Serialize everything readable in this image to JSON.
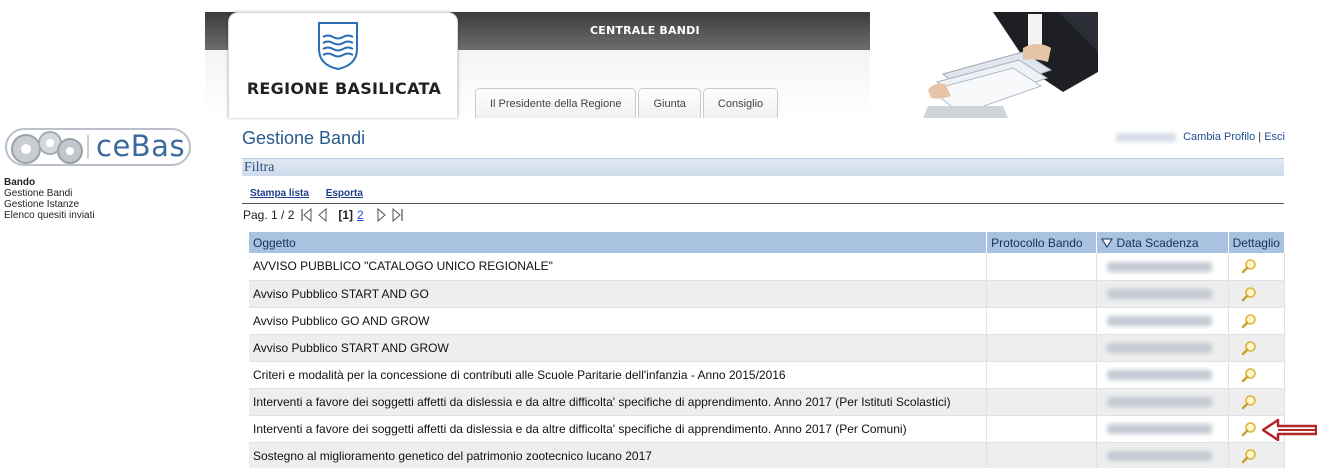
{
  "header": {
    "app_title": "CENTRALE BANDI",
    "region_name": "REGIONE BASILICATA",
    "tabs": [
      {
        "label": "Il Presidente della Regione"
      },
      {
        "label": "Giunta"
      },
      {
        "label": "Consiglio"
      }
    ]
  },
  "sidebar": {
    "logo_text": "ceBas",
    "items": [
      {
        "label": "Bando",
        "active": true
      },
      {
        "label": "Gestione Bandi"
      },
      {
        "label": "Gestione Istanze"
      },
      {
        "label": "Elenco quesiti inviati"
      }
    ]
  },
  "main": {
    "page_title": "Gestione Bandi",
    "top_links": {
      "change_profile": "Cambia Profilo",
      "separator": "|",
      "exit": "Esci"
    },
    "filter_label": "Filtra",
    "actions": {
      "print_list": "Stampa lista",
      "export": "Esporta"
    },
    "pager": {
      "label": "Pag. 1 / 2",
      "current": "[1]",
      "next_page": "2"
    },
    "table": {
      "columns": [
        "Oggetto",
        "Protocollo Bando",
        "Data Scadenza",
        "Dettaglio"
      ],
      "rows": [
        {
          "oggetto": "AVVISO PUBBLICO \"CATALOGO UNICO REGIONALE\""
        },
        {
          "oggetto": "Avviso Pubblico START AND GO"
        },
        {
          "oggetto": "Avviso Pubblico GO AND GROW"
        },
        {
          "oggetto": "Avviso Pubblico START AND GROW"
        },
        {
          "oggetto": "Criteri e modalità per la concessione di contributi alle Scuole Paritarie dell'infanzia - Anno 2015/2016"
        },
        {
          "oggetto": "Interventi a favore dei soggetti affetti da dislessia e da altre difficolta' specifiche di apprendimento. Anno 2017 (Per Istituti Scolastici)"
        },
        {
          "oggetto": "Interventi a favore dei soggetti affetti da dislessia e da altre difficolta' specifiche di apprendimento. Anno 2017 (Per Comuni)"
        },
        {
          "oggetto": "Sostegno al miglioramento genetico del patrimonio zootecnico lucano 2017"
        }
      ]
    }
  },
  "colors": {
    "title_blue": "#2a5a8c",
    "table_header": "#a9c2e0",
    "annotation_arrow": "#b3262a"
  }
}
